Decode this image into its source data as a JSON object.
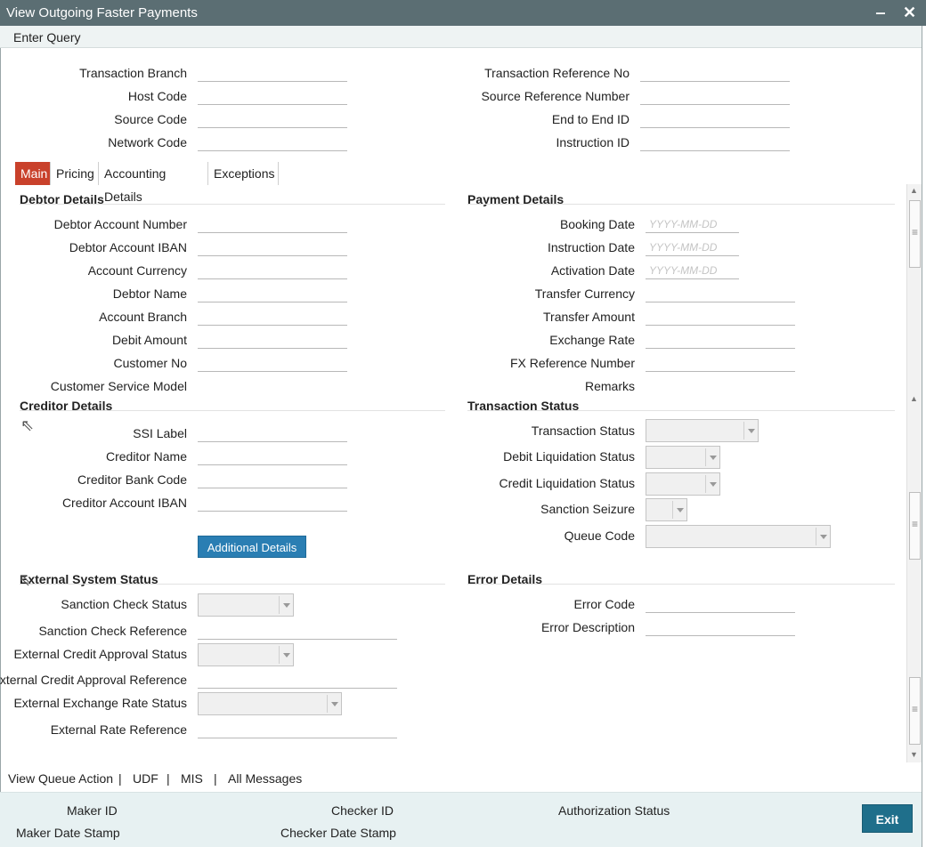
{
  "window": {
    "title": "View Outgoing Faster Payments",
    "minimize_glyph": "‒",
    "close_glyph": "✕"
  },
  "menu": {
    "enter_query": "Enter Query"
  },
  "header_fields": {
    "left": [
      "Transaction Branch",
      "Host Code",
      "Source Code",
      "Network Code"
    ],
    "right": [
      "Transaction Reference No",
      "Source Reference Number",
      "End to End ID",
      "Instruction ID"
    ]
  },
  "tabs": [
    "Main",
    "Pricing",
    "Accounting Details",
    "Exceptions"
  ],
  "debtor": {
    "title": "Debtor Details",
    "labels": [
      "Debtor Account Number",
      "Debtor Account IBAN",
      "Account Currency",
      "Debtor Name",
      "Account Branch",
      "Debit Amount",
      "Customer No",
      "Customer Service Model"
    ]
  },
  "payment": {
    "title": "Payment Details",
    "labels": [
      "Booking Date",
      "Instruction Date",
      "Activation Date",
      "Transfer Currency",
      "Transfer Amount",
      "Exchange Rate",
      "FX Reference Number",
      "Remarks"
    ],
    "date_placeholder": "YYYY-MM-DD"
  },
  "creditor": {
    "title": "Creditor Details",
    "labels": [
      "SSI Label",
      "Creditor Name",
      "Creditor Bank Code",
      "Creditor Account IBAN"
    ],
    "additional_button": "Additional Details"
  },
  "txn_status": {
    "title": "Transaction Status",
    "labels": [
      "Transaction Status",
      "Debit Liquidation Status",
      "Credit Liquidation Status",
      "Sanction Seizure",
      "Queue Code"
    ]
  },
  "external": {
    "title": "External System Status",
    "labels": [
      "Sanction Check Status",
      "Sanction Check Reference",
      "External Credit Approval Status",
      "External Credit Approval Reference",
      "External Exchange Rate Status",
      "External Rate Reference"
    ]
  },
  "error": {
    "title": "Error Details",
    "labels": [
      "Error Code",
      "Error Description"
    ]
  },
  "bottom_links": [
    "View Queue Action",
    "|",
    "UDF",
    "|",
    "MIS",
    "|",
    "All Messages"
  ],
  "footer": {
    "maker_id": "Maker ID",
    "maker_date": "Maker Date Stamp",
    "checker_id": "Checker ID",
    "checker_date": "Checker Date Stamp",
    "auth_status": "Authorization Status",
    "exit": "Exit"
  }
}
